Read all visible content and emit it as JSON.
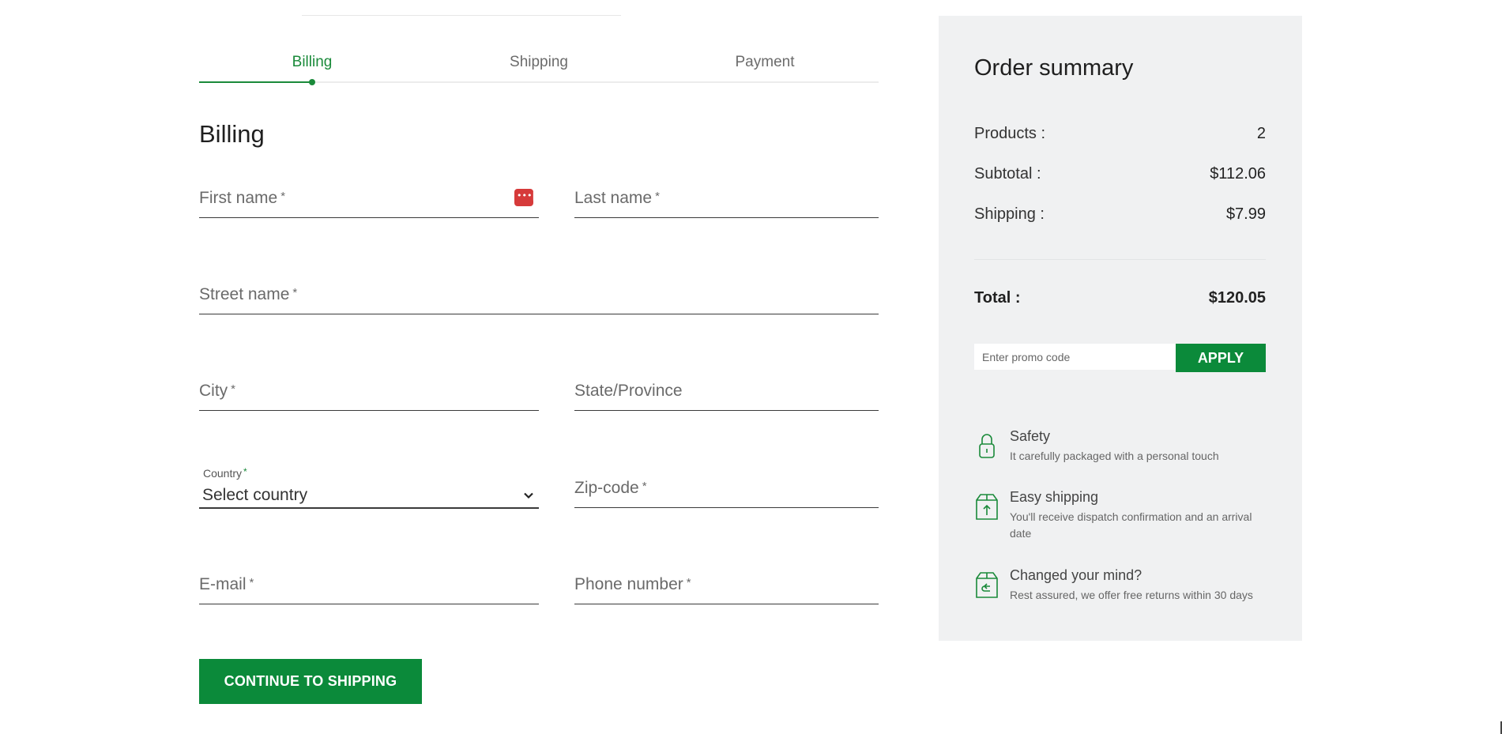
{
  "steps": {
    "items": [
      {
        "label": "Billing",
        "active": true
      },
      {
        "label": "Shipping",
        "active": false
      },
      {
        "label": "Payment",
        "active": false
      }
    ],
    "accent_color": "#1a8a3a"
  },
  "billing": {
    "title": "Billing",
    "first_name": {
      "label": "First name",
      "required": "*"
    },
    "last_name": {
      "label": "Last name",
      "required": "*"
    },
    "street": {
      "label": "Street name",
      "required": "*"
    },
    "city": {
      "label": "City",
      "required": "*"
    },
    "state": {
      "label": "State/Province"
    },
    "country": {
      "label": "Country",
      "required": "*",
      "value": "Select country"
    },
    "zip": {
      "label": "Zip-code",
      "required": "*"
    },
    "email": {
      "label": "E-mail",
      "required": "*"
    },
    "phone": {
      "label": "Phone number",
      "required": "*"
    },
    "continue_label": "CONTINUE TO SHIPPING"
  },
  "summary": {
    "title": "Order summary",
    "products_label": "Products :",
    "products_value": "2",
    "subtotal_label": "Subtotal :",
    "subtotal_value": "$112.06",
    "shipping_label": "Shipping :",
    "shipping_value": "$7.99",
    "total_label": "Total :",
    "total_value": "$120.05",
    "promo_placeholder": "Enter promo code",
    "apply_label": "APPLY",
    "features": [
      {
        "title": "Safety",
        "desc": "It carefully packaged with a personal touch",
        "icon": "lock-icon"
      },
      {
        "title": "Easy shipping",
        "desc": "You'll receive dispatch confirmation and an arrival date",
        "icon": "box-upload-icon"
      },
      {
        "title": "Changed your mind?",
        "desc": "Rest assured, we offer free returns within 30 days",
        "icon": "box-return-icon"
      }
    ]
  }
}
